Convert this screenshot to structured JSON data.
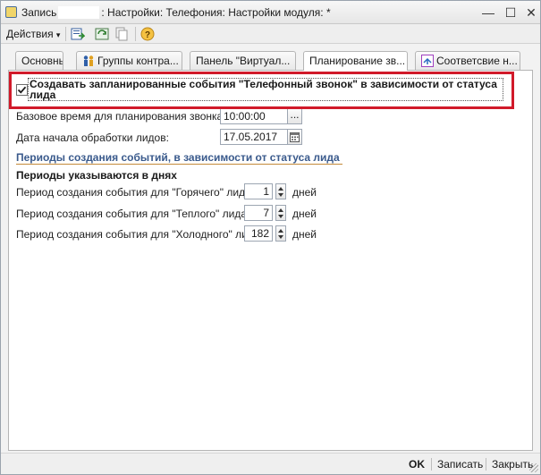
{
  "window": {
    "title_prefix": "Запись",
    "title_suffix": ": Настройки: Телефония: Настройки модуля:",
    "title_modified": "*",
    "minimize": "—",
    "maximize": "☐",
    "close": "✕"
  },
  "toolbar": {
    "actions_label": "Действия",
    "actions_arrow": "▾"
  },
  "tabs": [
    {
      "label": "Основные"
    },
    {
      "label": "Группы контра..."
    },
    {
      "label": "Панель \"Виртуал..."
    },
    {
      "label": "Планирование зв..."
    },
    {
      "label": "Соответсвие н..."
    }
  ],
  "active_tab": 3,
  "form": {
    "schedule_checkbox": {
      "checked": true,
      "label": "Создавать запланированные события \"Телефонный звонок\" в зависимости от статуса лида"
    },
    "base_time": {
      "label": "Базовое время для планирования звонка:",
      "value": "10:00:00",
      "button": "..."
    },
    "start_date": {
      "label": "Дата начала обработки лидов:",
      "value": "17.05.2017"
    },
    "section_title": "Периоды создания событий, в зависимости от статуса лида",
    "sub_title": "Периоды указываются в днях",
    "periods": [
      {
        "label": "Период создания события для \"Горячего\" лида:",
        "value": "1",
        "unit": "дней"
      },
      {
        "label": "Период создания события для \"Теплого\" лида:",
        "value": "7",
        "unit": "дней"
      },
      {
        "label": "Период создания события для \"Холодного\" лида:",
        "value": "182",
        "unit": "дней"
      }
    ]
  },
  "footer": {
    "ok": "OK",
    "save": "Записать",
    "close": "Закрыть"
  },
  "colors": {
    "highlight": "#d11a2a",
    "section_title": "#3a5a8c",
    "section_line": "#c48a3a"
  }
}
